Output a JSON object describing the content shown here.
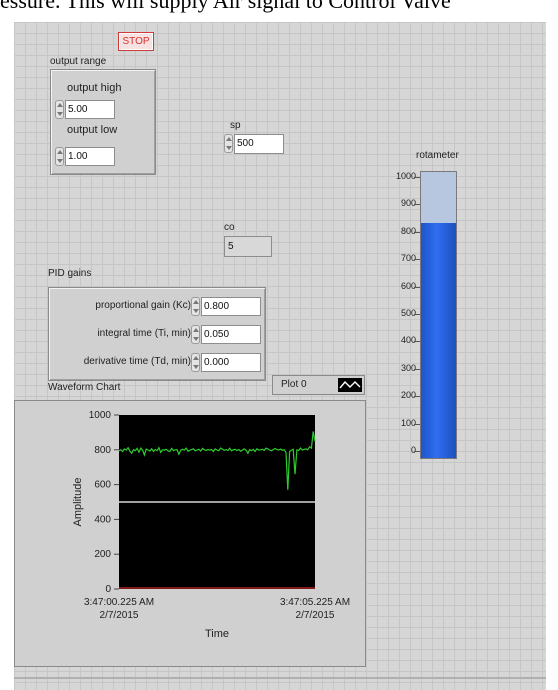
{
  "caption": "essure. This will supply Air signal to Control Valve",
  "stop": {
    "label": "STOP"
  },
  "output_range": {
    "title": "output range",
    "high_label": "output high",
    "high_value": "5.00",
    "low_label": "output low",
    "low_value": "1.00"
  },
  "sp": {
    "label": "sp",
    "value": "500"
  },
  "co": {
    "label": "co",
    "value": "5"
  },
  "pid": {
    "title": "PID gains",
    "kc_label": "proportional gain (Kc)",
    "kc_value": "0.800",
    "ti_label": "integral time (Ti, min)",
    "ti_value": "0.050",
    "td_label": "derivative time (Td, min)",
    "td_value": "0.000"
  },
  "rotameter": {
    "label": "rotameter",
    "ticks": [
      "1000",
      "900",
      "800",
      "700",
      "600",
      "500",
      "400",
      "300",
      "200",
      "100",
      "0"
    ],
    "level": 830,
    "max": 1000
  },
  "chart": {
    "title": "Waveform Chart",
    "legend_label": "Plot 0",
    "ylabel": "Amplitude",
    "xlabel": "Time",
    "yticks": [
      "1000",
      "800",
      "600",
      "400",
      "200",
      "0"
    ],
    "x_start_time": "3:47:00.225 AM",
    "x_start_date": "2/7/2015",
    "x_end_time": "3:47:05.225 AM",
    "x_end_date": "2/7/2015",
    "colors": {
      "trace": "#2ecc2e",
      "setpoint": "#ffffff",
      "background": "#000000",
      "co_line": "#ff3030"
    }
  },
  "chart_data": {
    "type": "line",
    "ylim": [
      0,
      1000
    ],
    "series": [
      {
        "values": [
          795,
          800,
          790,
          805,
          798,
          812,
          792,
          780,
          801,
          795,
          808,
          787,
          810,
          797,
          770,
          804,
          799,
          793,
          806,
          790,
          802,
          795,
          812,
          785,
          800,
          798,
          803,
          794,
          790,
          808,
          796,
          800,
          801,
          775,
          797,
          803,
          799,
          810,
          792,
          797,
          801,
          806,
          794,
          799,
          803,
          793,
          808,
          800,
          796,
          802,
          798,
          801,
          790,
          805,
          799,
          795,
          810,
          804,
          797,
          801,
          796,
          809,
          794,
          800,
          803,
          796,
          802,
          792,
          798,
          806,
          799,
          780,
          801,
          795,
          803,
          790,
          806,
          798,
          800,
          803,
          797,
          810,
          805,
          799,
          794,
          801,
          808,
          802,
          799,
          804,
          797,
          801,
          785,
          570,
          790,
          798,
          803,
          660,
          800,
          796,
          810,
          799,
          803,
          805,
          800,
          818,
          810,
          905,
          850
        ]
      },
      {
        "values": [
          500,
          500
        ]
      }
    ]
  }
}
